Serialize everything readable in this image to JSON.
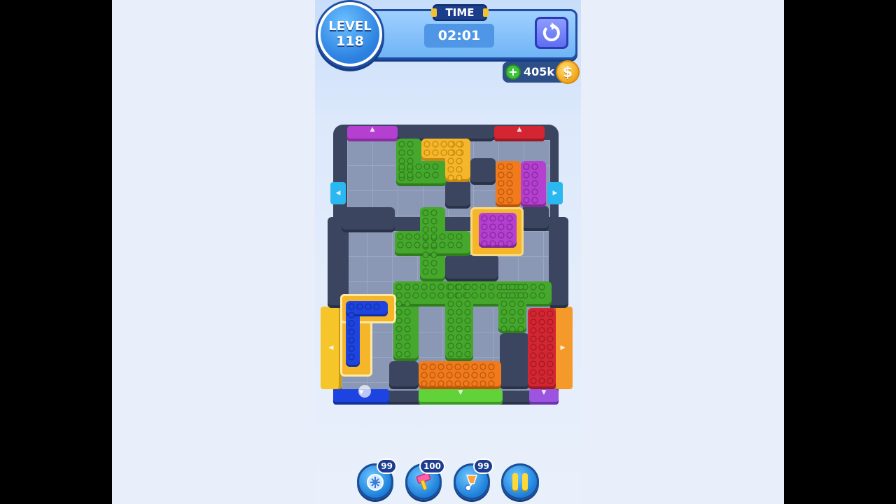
{
  "hud": {
    "level_label": "LEVEL",
    "level_number": "118",
    "time_label": "TIME",
    "time_value": "02:01",
    "coins": "405k",
    "coin_symbol": "$",
    "plus_symbol": "+"
  },
  "tools": [
    {
      "name": "freeze",
      "count": "99",
      "icon": "snowflake-clock-icon"
    },
    {
      "name": "hammer",
      "count": "100",
      "icon": "hammer-icon"
    },
    {
      "name": "vacuum",
      "count": "99",
      "icon": "vacuum-icon"
    },
    {
      "name": "pause",
      "icon": "pause-icon"
    }
  ],
  "gate_arrows": {
    "up": "▲",
    "down": "▼",
    "left": "◀",
    "right": "▶"
  },
  "colors": {
    "green": "#45a82c",
    "yellow": "#f5b62a",
    "orange": "#f07a1c",
    "magenta": "#b43fd0",
    "blue": "#1d44e0",
    "red": "#d42532",
    "cyan": "#2bb7f0",
    "wall": "#3b4560"
  }
}
